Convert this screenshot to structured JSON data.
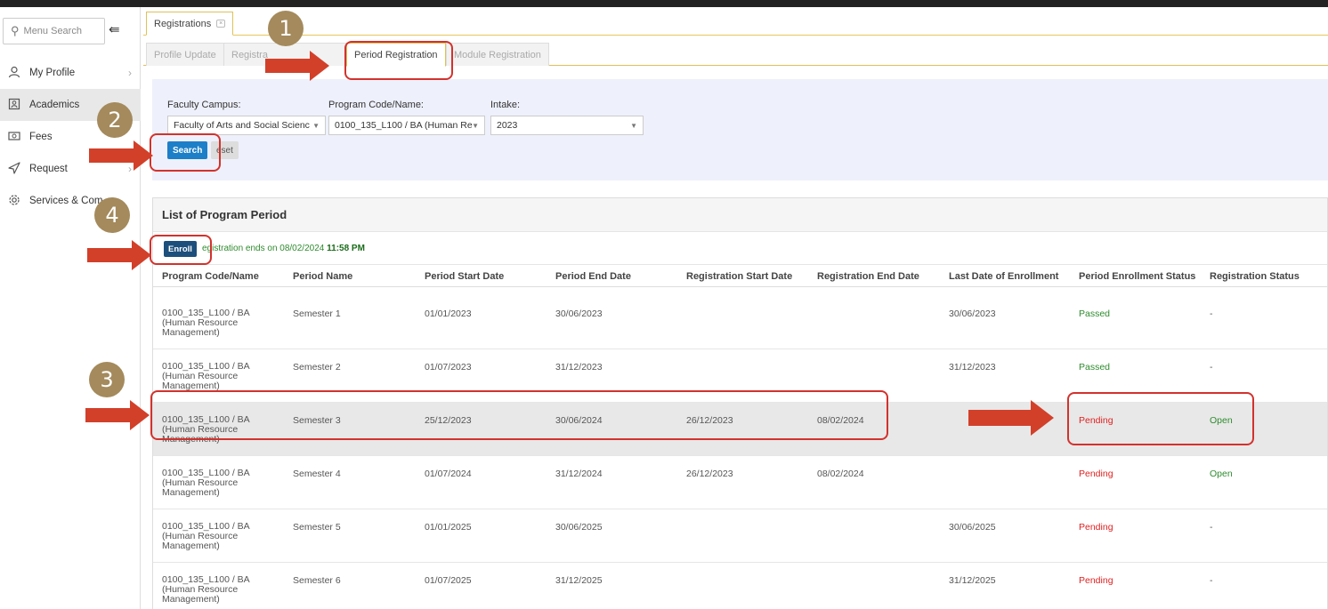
{
  "sidebar": {
    "search_placeholder": "Menu Search",
    "items": [
      {
        "label": "My Profile",
        "icon": "user-icon",
        "chevron": "›"
      },
      {
        "label": "Academics",
        "icon": "id-card-icon"
      },
      {
        "label": "Fees",
        "icon": "money-icon"
      },
      {
        "label": "Request",
        "icon": "paper-plane-icon",
        "chevron": "›"
      },
      {
        "label": "Services & Com",
        "icon": "gear-icon"
      }
    ]
  },
  "outer_tab": {
    "label": "Registrations"
  },
  "inner_tabs": [
    "Profile Update",
    "Registra",
    "Period Registration",
    "Module Registration"
  ],
  "filters": {
    "faculty_label": "Faculty Campus:",
    "faculty_value": "Faculty of Arts and Social Scienc",
    "program_label": "Program Code/Name:",
    "program_value": "0100_135_L100 / BA (Human Re",
    "intake_label": "Intake:",
    "intake_value": "2023",
    "search_label": "Search",
    "reset_label": "eset"
  },
  "list": {
    "title": "List of Program Period",
    "enroll_label": "Enroll",
    "reg_note": "egistration ends on 08/02/2024",
    "reg_time": "11:58 PM",
    "columns": [
      "Program Code/Name",
      "Period Name",
      "Period Start Date",
      "Period End Date",
      "Registration Start Date",
      "Registration End Date",
      "Last Date of Enrollment",
      "Period Enrollment Status",
      "Registration Status"
    ],
    "rows": [
      {
        "program": "0100_135_L100 / BA (Human Resource Management)",
        "period": "Semester 1",
        "start": "01/01/2023",
        "end": "30/06/2023",
        "reg_start": "",
        "reg_end": "",
        "last_date": "30/06/2023",
        "enroll_status": "Passed",
        "reg_status": "-"
      },
      {
        "program": "0100_135_L100 / BA (Human Resource Management)",
        "period": "Semester 2",
        "start": "01/07/2023",
        "end": "31/12/2023",
        "reg_start": "",
        "reg_end": "",
        "last_date": "31/12/2023",
        "enroll_status": "Passed",
        "reg_status": "-"
      },
      {
        "program": "0100_135_L100 / BA (Human Resource Management)",
        "period": "Semester 3",
        "start": "25/12/2023",
        "end": "30/06/2024",
        "reg_start": "26/12/2023",
        "reg_end": "08/02/2024",
        "last_date": "",
        "enroll_status": "Pending",
        "reg_status": "Open"
      },
      {
        "program": "0100_135_L100 / BA (Human Resource Management)",
        "period": "Semester 4",
        "start": "01/07/2024",
        "end": "31/12/2024",
        "reg_start": "26/12/2023",
        "reg_end": "08/02/2024",
        "last_date": "",
        "enroll_status": "Pending",
        "reg_status": "Open"
      },
      {
        "program": "0100_135_L100 / BA (Human Resource Management)",
        "period": "Semester 5",
        "start": "01/01/2025",
        "end": "30/06/2025",
        "reg_start": "",
        "reg_end": "",
        "last_date": "30/06/2025",
        "enroll_status": "Pending",
        "reg_status": "-"
      },
      {
        "program": "0100_135_L100 / BA (Human Resource Management)",
        "period": "Semester 6",
        "start": "01/07/2025",
        "end": "31/12/2025",
        "reg_start": "",
        "reg_end": "",
        "last_date": "31/12/2025",
        "enroll_status": "Pending",
        "reg_status": "-"
      }
    ]
  },
  "annotations": {
    "step1": "1",
    "step2": "2",
    "step3": "3",
    "step4": "4",
    "badge_color": "#a48a5c",
    "arrow_color": "#d2402a"
  }
}
